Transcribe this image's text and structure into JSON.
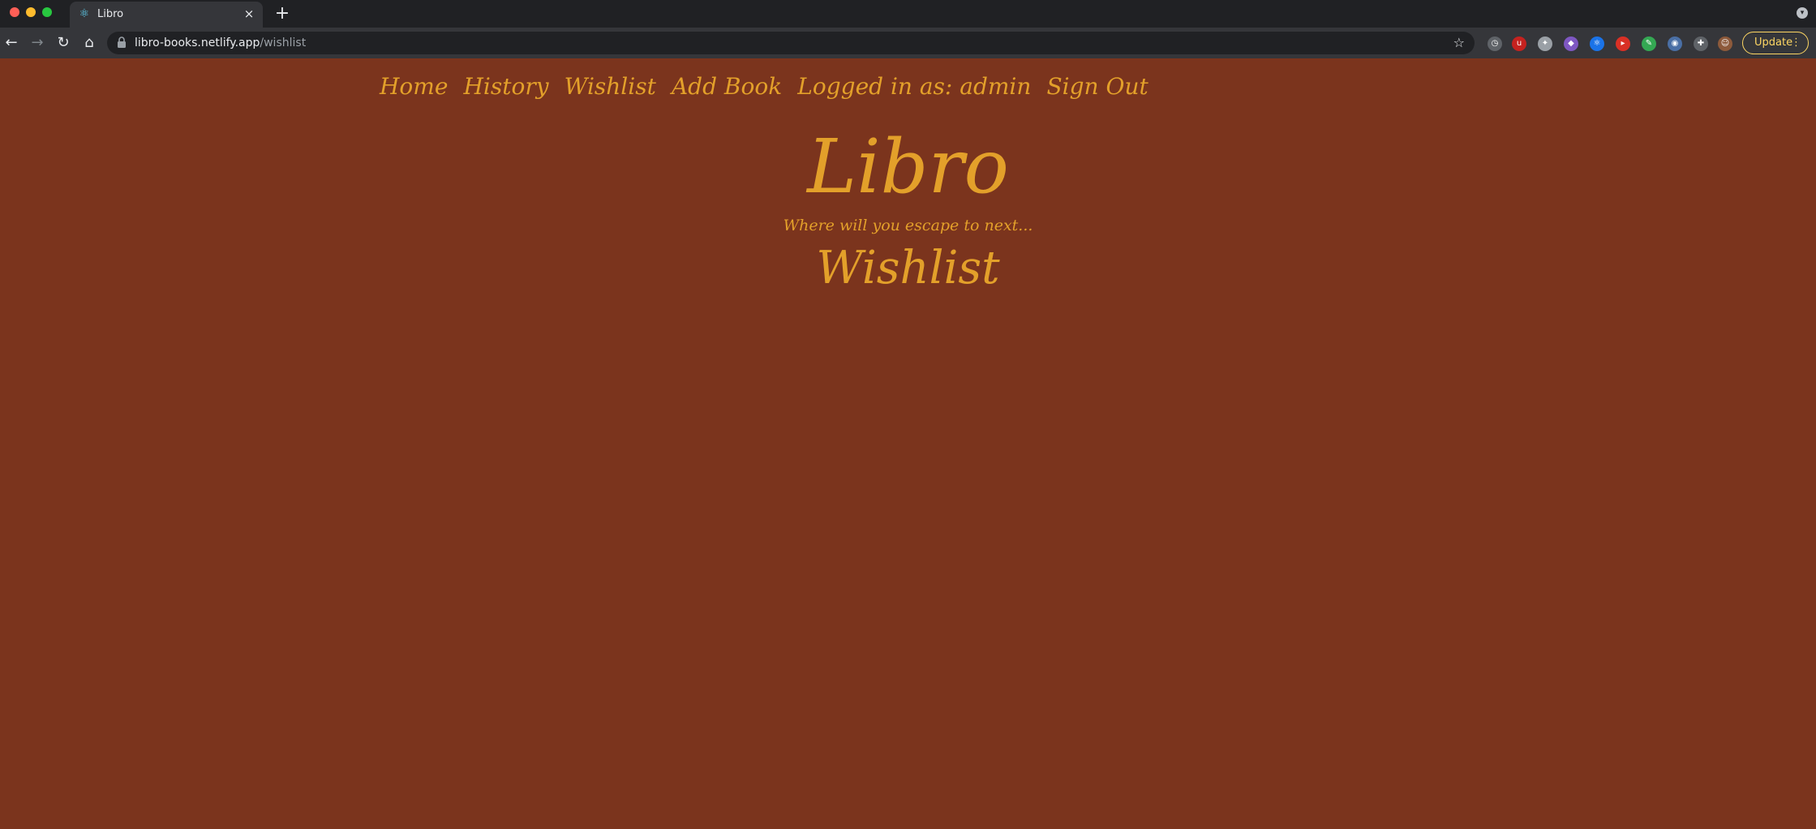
{
  "browser": {
    "tab_title": "Libro",
    "tab_close": "×",
    "new_tab": "+",
    "url_host": "libro-books.netlify.app",
    "url_path": "/wishlist",
    "update_label": "Update",
    "update_menu": "⋮"
  },
  "nav": {
    "home": "Home",
    "history": "History",
    "wishlist": "Wishlist",
    "add_book": "Add Book",
    "logged_in": "Logged in as: admin",
    "sign_out": "Sign Out"
  },
  "site": {
    "title": "Libro",
    "tagline": "Where will you escape to next...",
    "page_heading": "Wishlist"
  },
  "colors": {
    "page_background": "#7b341d",
    "accent_text": "#e3a02a"
  }
}
